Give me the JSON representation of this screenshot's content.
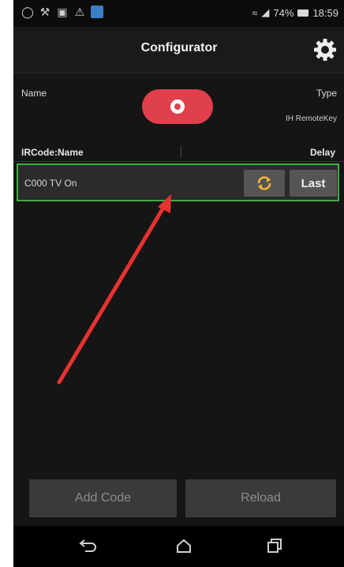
{
  "status_bar": {
    "signal_percent": "74%",
    "time": "18:59",
    "left_icons": [
      "whatsapp-icon",
      "tools-icon",
      "image-icon",
      "warning-icon",
      "app-icon"
    ]
  },
  "action_bar": {
    "title": "Configurator",
    "settings_icon": "gear-icon"
  },
  "header": {
    "name_label": "Name",
    "type_label": "Type",
    "type_value": "IH RemoteKey",
    "record_icon": "record-icon"
  },
  "table": {
    "col_name": "IRCode:Name",
    "col_delay": "Delay",
    "rows": [
      {
        "code_name": "C000 TV On",
        "refresh_icon": "refresh-icon",
        "delay_label": "Last"
      }
    ]
  },
  "buttons": {
    "add_code": "Add Code",
    "reload": "Reload"
  },
  "nav": {
    "icons": [
      "back-icon",
      "home-icon",
      "recents-icon"
    ]
  },
  "colors": {
    "accent_red": "#e0404c",
    "highlight_green": "#3fae3f",
    "background": "#151515"
  }
}
